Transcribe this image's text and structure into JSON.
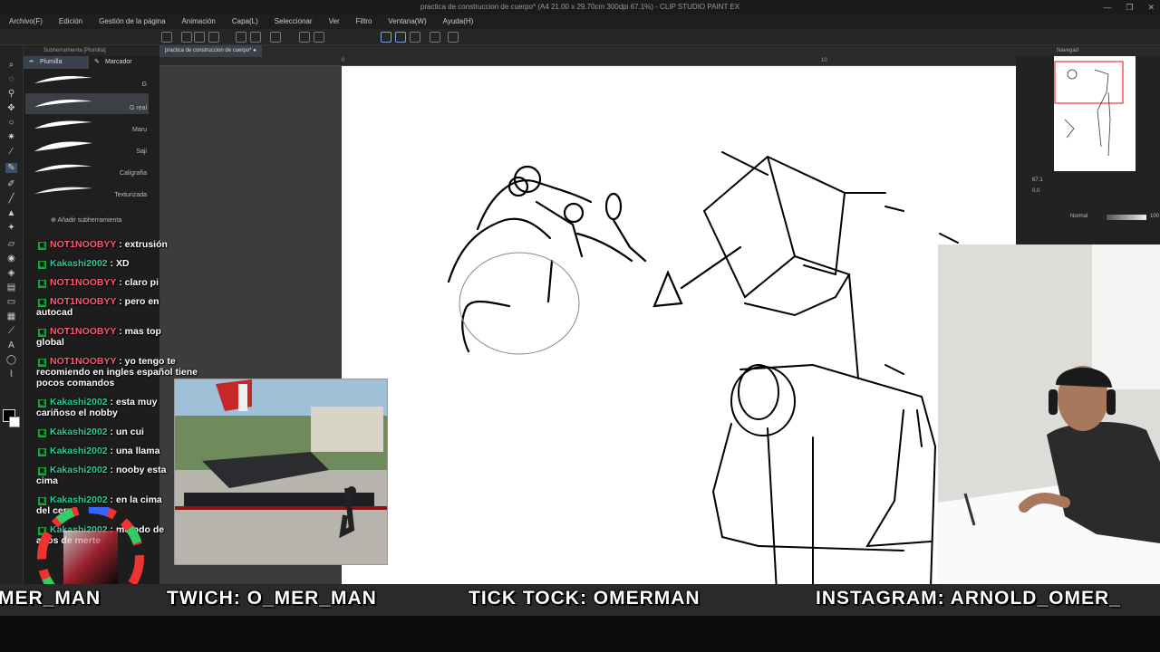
{
  "window": {
    "title": "practica de construccion de cuerpo* (A4 21.00 x 29.70cm 300dpi 67.1%) - CLIP STUDIO PAINT EX",
    "controls": [
      "—",
      "❐",
      "✕"
    ]
  },
  "menu": [
    "Archivo(F)",
    "Edición",
    "Gestión de la página",
    "Animación",
    "Capa(L)",
    "Seleccionar",
    "Ver",
    "Filtro",
    "Ventana(W)",
    "Ayuda(H)"
  ],
  "subtool": {
    "header": "Subherramienta [Plumilla]",
    "tabs": [
      "Plumilla",
      "Marcador"
    ],
    "brushes": [
      {
        "label": "G"
      },
      {
        "label": "G real"
      },
      {
        "label": "Maru"
      },
      {
        "label": "Saji"
      },
      {
        "label": "Caligrafía"
      },
      {
        "label": "Texturizada"
      }
    ],
    "add_label": "Añadir subherramienta"
  },
  "document": {
    "tab_label": "practica de construccion de cuerpo*",
    "ruler_marks": [
      "0",
      "10"
    ]
  },
  "navigator": {
    "title": "Navegad",
    "zoom": "67.1",
    "rotation": "0.0"
  },
  "layer": {
    "blend_mode": "Normal",
    "opacity": "100"
  },
  "chat": [
    {
      "user": "NOT1NOOBYY",
      "color": "#ff4f6b",
      "message": "extrusión"
    },
    {
      "user": "Kakashi2002",
      "color": "#1fd19a",
      "message": "XD"
    },
    {
      "user": "NOT1NOOBYY",
      "color": "#ff4f6b",
      "message": "claro pi"
    },
    {
      "user": "NOT1NOOBYY",
      "color": "#ff4f6b",
      "message": "pero en autocad"
    },
    {
      "user": "NOT1NOOBYY",
      "color": "#ff4f6b",
      "message": "mas top global"
    },
    {
      "user": "NOT1NOOBYY",
      "color": "#ff4f6b",
      "message": "yo tengo te recomiendo en ingles español tiene pocos comandos"
    },
    {
      "user": "Kakashi2002",
      "color": "#1fd19a",
      "message": "esta muy cariñoso el nobby"
    },
    {
      "user": "Kakashi2002",
      "color": "#1fd19a",
      "message": "un cui"
    },
    {
      "user": "Kakashi2002",
      "color": "#1fd19a",
      "message": "una llama"
    },
    {
      "user": "Kakashi2002",
      "color": "#1fd19a",
      "message": "nooby esta cima"
    },
    {
      "user": "Kakashi2002",
      "color": "#1fd19a",
      "message": "en la cima del cerro"
    },
    {
      "user": "Kakashi2002",
      "color": "#1fd19a",
      "message": "metodo de años de merte"
    }
  ],
  "ticker": {
    "left_fragment": "MER_MAN",
    "twitch": "TWICH: O_MER_MAN",
    "tiktok": "TICK TOCK: OMERMAN",
    "instagram": "INSTAGRAM: ARNOLD_OMER_"
  }
}
